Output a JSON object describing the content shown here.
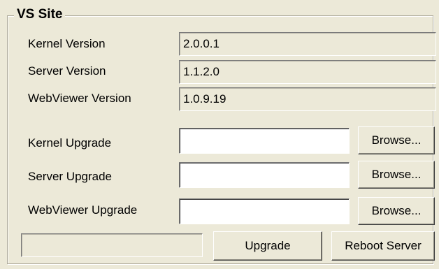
{
  "group": {
    "title": "VS Site"
  },
  "versions": {
    "kernel": {
      "label": "Kernel Version",
      "value": "2.0.0.1"
    },
    "server": {
      "label": "Server Version",
      "value": "1.1.2.0"
    },
    "webviewer": {
      "label": "WebViewer Version",
      "value": "1.0.9.19"
    }
  },
  "upgrades": {
    "kernel": {
      "label": "Kernel Upgrade",
      "value": "",
      "browse_label": "Browse..."
    },
    "server": {
      "label": "Server Upgrade",
      "value": "",
      "browse_label": "Browse..."
    },
    "webviewer": {
      "label": "WebViewer Upgrade",
      "value": "",
      "browse_label": "Browse..."
    }
  },
  "progress": {
    "value_percent": 0
  },
  "actions": {
    "upgrade_label": "Upgrade",
    "reboot_label": "Reboot Server"
  },
  "colors": {
    "window_bg": "#ece9d8",
    "edit_bg": "#ffffff",
    "progress_fill": "#3169c6"
  }
}
